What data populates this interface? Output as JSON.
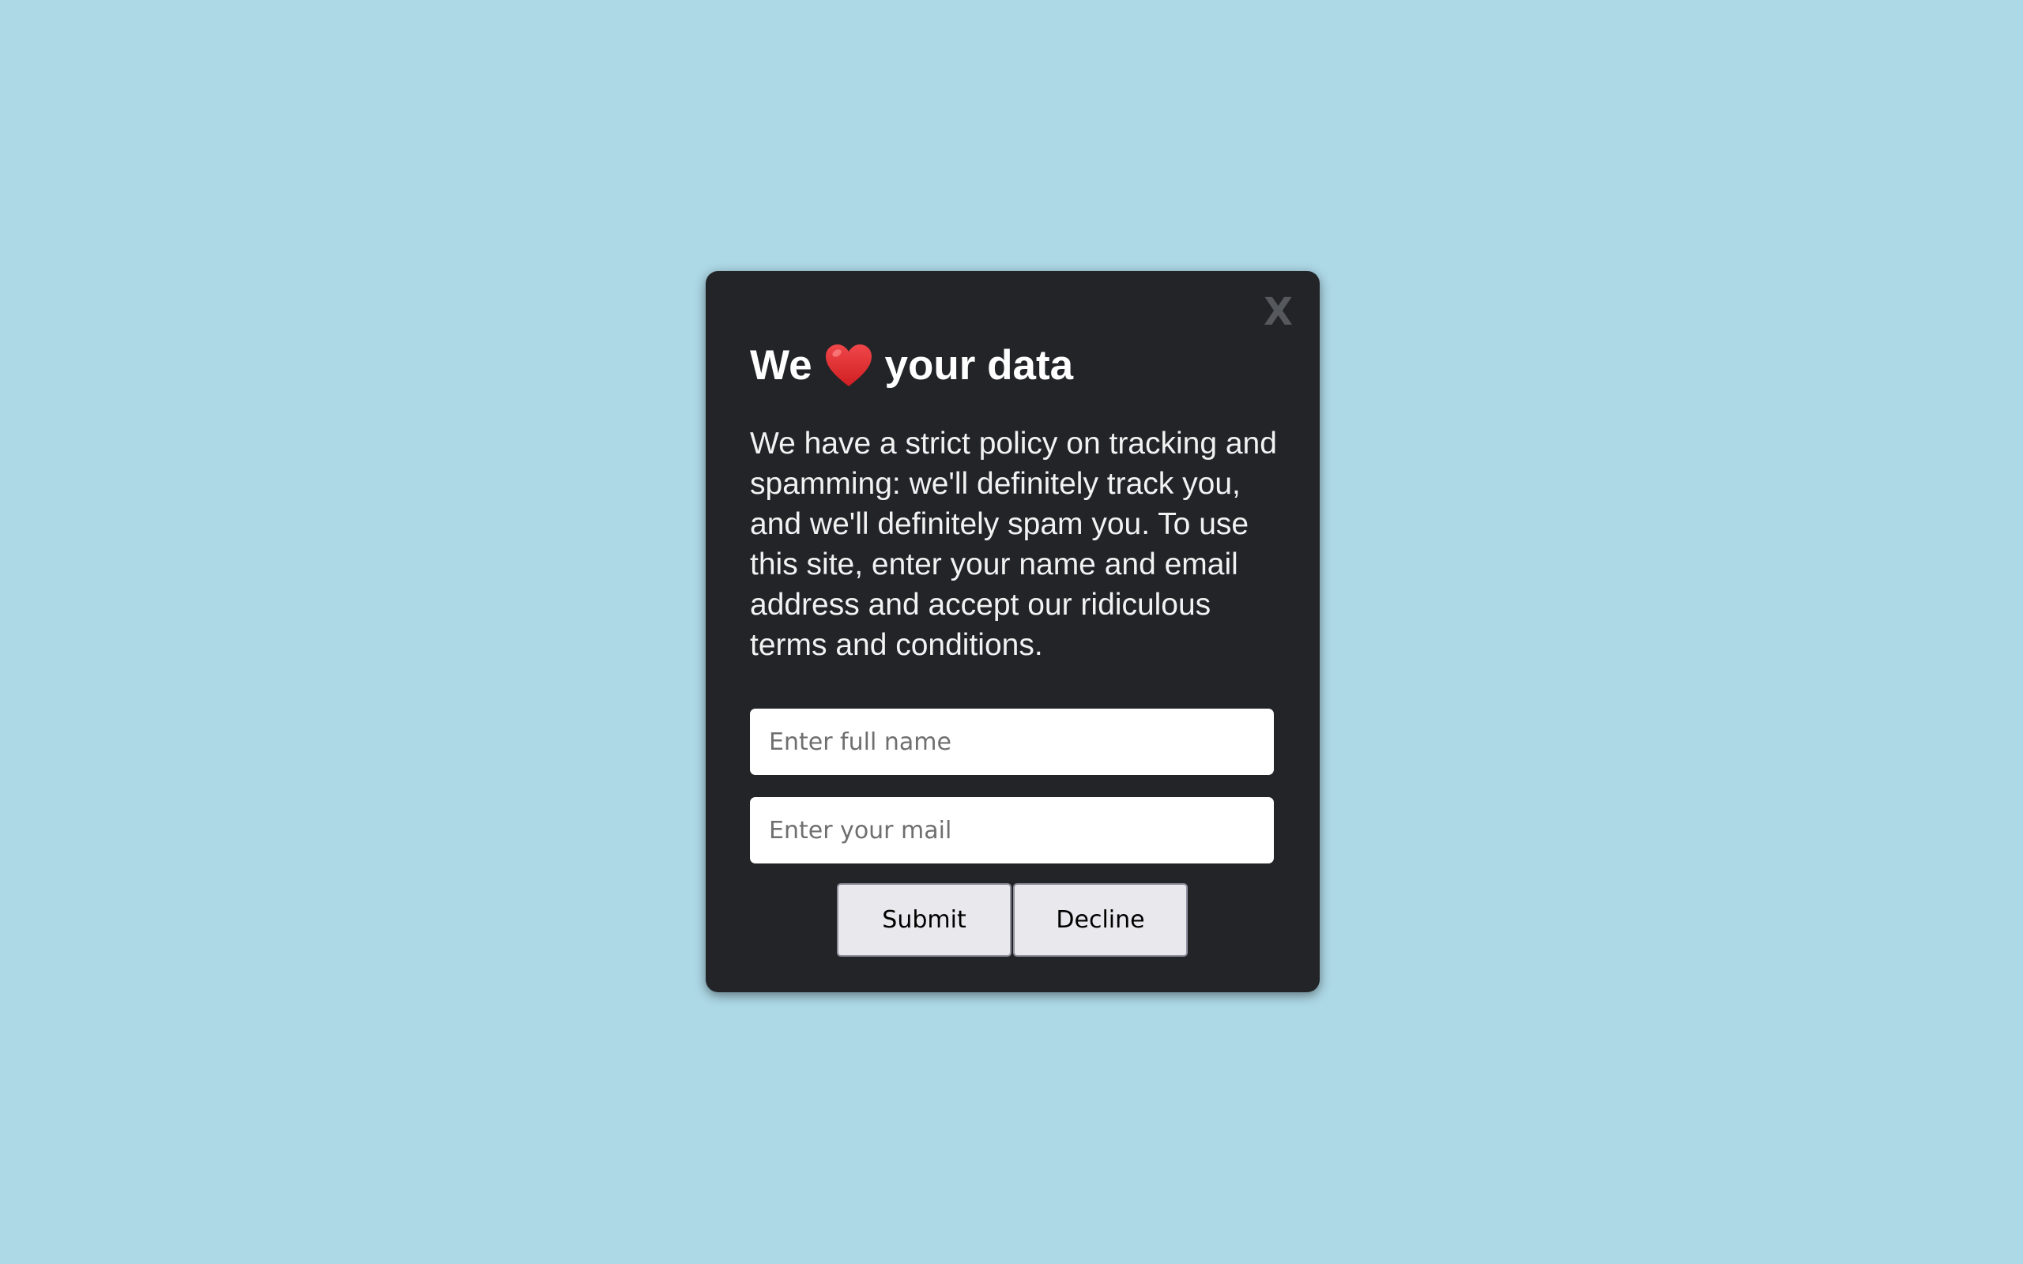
{
  "modal": {
    "close_label": "X",
    "title_before": "We",
    "title_icon": "heart-icon",
    "title_after": "your data",
    "description": "We have a strict policy on tracking and spamming: we'll definitely track you, and we'll definitely spam you. To use this site, enter your name and email address and accept our ridiculous terms and conditions.",
    "name_placeholder": "Enter full name",
    "mail_placeholder": "Enter your mail",
    "submit_label": "Submit",
    "decline_label": "Decline"
  },
  "colors": {
    "background": "#add8e6",
    "modal_bg": "#222428",
    "heart": "#e8282b"
  }
}
